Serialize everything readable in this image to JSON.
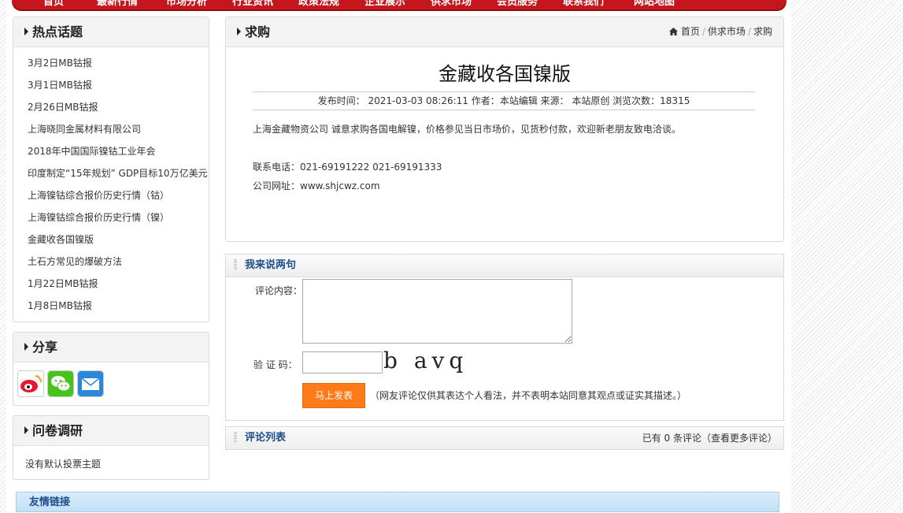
{
  "nav": {
    "items": [
      "首页",
      "最新行情",
      "市场分析",
      "行业资讯",
      "政策法规",
      "企业展示",
      "供求市场",
      "会员服务",
      "联系我们",
      "网站地图"
    ]
  },
  "sidebar": {
    "hot_title": "热点话题",
    "hot_items": [
      "3月2日MB钴报",
      "3月1日MB钴报",
      "2月26日MB钴报",
      "上海晓同金属材料有限公司",
      "2018年中国国际镍钴工业年会",
      "印度制定“15年规划” GDP目标10万亿美元",
      "上海镍钴综合报价历史行情（钴）",
      "上海镍钴综合报价历史行情（镍）",
      "金藏收各国镍版",
      "土石方常见的爆破方法",
      "1月22日MB钴报",
      "1月8日MB钴报"
    ],
    "share_title": "分享",
    "share_icons": [
      "weibo-icon",
      "wechat-icon",
      "email-icon"
    ],
    "survey_title": "问卷调研",
    "survey_text": "没有默认投票主题"
  },
  "main": {
    "section_title": "求购",
    "breadcrumb": [
      "首页",
      "供求市场",
      "求购"
    ],
    "article": {
      "title": "金藏收各国镍版",
      "meta": "发布时间： 2021-03-03 08:26:11   作者：本站编辑   来源： 本站原创   浏览次数：18315",
      "body": "上海金藏物资公司 诚意求购各国电解镍，价格参见当日市场价，见货秒付款，欢迎新老朋友致电洽谈。",
      "phone": "联系电话：021-69191222   021-69191333",
      "website": "公司网址：www.shjcwz.com"
    }
  },
  "comment": {
    "title": "我来说两句",
    "content_label": "评论内容：",
    "captcha_label": "验 证 码：",
    "captcha_text": "b avq",
    "submit_label": "马上发表",
    "disclaimer": "（网友评论仅供其表达个人看法，并不表明本站同意其观点或证实其描述。）"
  },
  "comment_list": {
    "title": "评论列表",
    "summary": "已有 0 条评论（查看更多评论）"
  },
  "friend_links": {
    "title": "友情链接"
  }
}
